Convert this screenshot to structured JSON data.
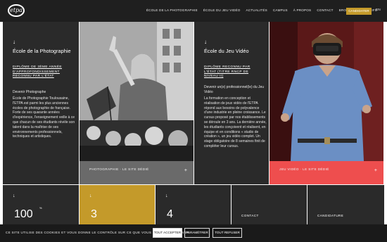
{
  "header": {
    "logo_text": "etpa",
    "nav": [
      "École de la photographie",
      "École du jeu vidéo",
      "Actualités",
      "Campus",
      "À propos",
      "Contact",
      "Brochures & tarifs"
    ],
    "cta": "Candidater",
    "lang": "EN",
    "cta_color": "#c49a2a"
  },
  "photo_school": {
    "arrow": "↓",
    "title": "École de la Photographie",
    "badge": "Diplôme de 3ème année d'approfondissement reconnu par l'État",
    "subtitle": "Devenir Photographe",
    "body": "École de Photographie Toulousaine, l'ETPA est parmi les plus anciennes écoles de photographie de française. Forte de ses quarante années d'expérience, l'enseignement veille à ce que chacun de ses étudiants révèle son talent dans la maîtrise de ses environnements professionnels, techniques et artistiques.",
    "caption": "Photographie · Le site dédié",
    "caption_icon": "+"
  },
  "game_school": {
    "arrow": "↓",
    "title": "École du Jeu Vidéo",
    "badge": "Diplôme reconnu par l'État (titre RNCP de niveau II)",
    "subtitle": "Devenir un(e) professionnel(le) du Jeu Vidéo",
    "body": "La formation en conception et réalisation de jeux vidéo de l'ETPA répond aux besoins de polyvalence d'une industrie en pleine croissance. Le cursus proposé par nos établissements se déroule en 3 ans. La dernière année, les étudiants conçoivent et réalisent, en équipe et en conditions « studio de création », un jeu vidéo complet. Un stage obligatoire de 8 semaines finit de compléter leur cursus.",
    "caption": "Jeu vidéo · Le site dédié",
    "caption_icon": "+",
    "accent_color": "#ee4e4e"
  },
  "tiles": [
    {
      "arrow": "↓",
      "number": "100",
      "sup": "%",
      "bg": "#2a2a2a"
    },
    {
      "arrow": "↓",
      "number": "3",
      "bg": "#c49a2a"
    },
    {
      "arrow": "↓",
      "number": "4",
      "bg": "#2a2a2a"
    },
    {
      "label": "Contact",
      "bg": "#2a2a2a"
    },
    {
      "label": "Candidature",
      "bg": "#2a2a2a"
    }
  ],
  "cookie": {
    "text": "Ce site utilise des cookies et vous donne le contrôle sur ce que vous souhaitez activer",
    "accept": "Tout accepter",
    "settings": "Paramétrer",
    "refuse": "Tout refuser"
  }
}
